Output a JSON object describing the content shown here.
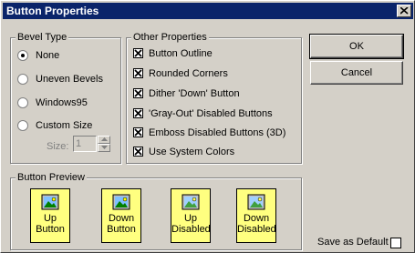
{
  "window": {
    "title": "Button Properties"
  },
  "bevel_type": {
    "label": "Bevel Type",
    "options": [
      {
        "label": "None",
        "checked": true
      },
      {
        "label": "Uneven Bevels",
        "checked": false
      },
      {
        "label": "Windows95",
        "checked": false
      },
      {
        "label": "Custom Size",
        "checked": false
      }
    ],
    "size_label": "Size:",
    "size_value": "1"
  },
  "other_properties": {
    "label": "Other Properties",
    "options": [
      {
        "label": "Button Outline",
        "checked": true
      },
      {
        "label": "Rounded Corners",
        "checked": true
      },
      {
        "label": "Dither 'Down' Button",
        "checked": true
      },
      {
        "label": "'Gray-Out' Disabled Buttons",
        "checked": true
      },
      {
        "label": "Emboss Disabled Buttons (3D)",
        "checked": true
      },
      {
        "label": "Use System Colors",
        "checked": true
      }
    ]
  },
  "buttons": {
    "ok": "OK",
    "cancel": "Cancel"
  },
  "preview": {
    "label": "Button Preview",
    "items": [
      {
        "line1": "Up",
        "line2": "Button",
        "icon": "picture-icon"
      },
      {
        "line1": "Down",
        "line2": "Button",
        "icon": "picture-icon"
      },
      {
        "line1": "Up",
        "line2": "Disabled",
        "icon": "picture-icon"
      },
      {
        "line1": "Down",
        "line2": "Disabled",
        "icon": "picture-icon"
      }
    ]
  },
  "save_default": {
    "label": "Save as Default",
    "checked": false
  },
  "colors": {
    "title_bar": "#0a246a",
    "face": "#d4d0c8",
    "preview_bg": "#ffff80"
  }
}
